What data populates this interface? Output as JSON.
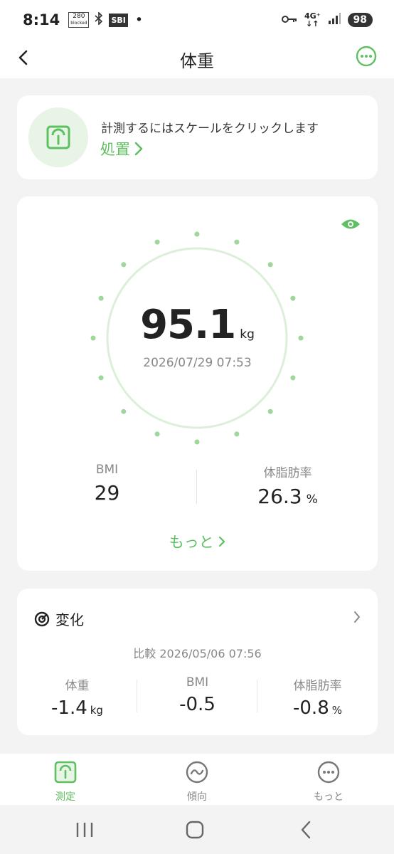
{
  "status_bar": {
    "time": "8:14",
    "notif_top": "280",
    "notif_bottom": "blocked",
    "sbi_label": "SBI",
    "dot": "•",
    "network_top": "4G⁺",
    "network_bottom": "↓↑",
    "battery": "98"
  },
  "header": {
    "title": "体重",
    "back_icon": "chevron-left-icon",
    "more_icon": "more-circle-icon",
    "accent": "#5fbf63"
  },
  "tip": {
    "text": "計測するにはスケールをクリックします",
    "action": "処置",
    "icon": "scale-icon"
  },
  "measurement": {
    "weight": "95.1",
    "unit": "kg",
    "datetime": "2026/07/29 07:53",
    "bmi_label": "BMI",
    "bmi_value": "29",
    "fat_label": "体脂肪率",
    "fat_value": "26.3",
    "fat_unit": "%",
    "more": "もっと"
  },
  "change": {
    "title": "変化",
    "compare": "比較 2026/05/06 07:56",
    "items": [
      {
        "label": "体重",
        "value": "-1.4",
        "unit": "kg"
      },
      {
        "label": "BMI",
        "value": "-0.5",
        "unit": ""
      },
      {
        "label": "体脂肪率",
        "value": "-0.8",
        "unit": "%"
      }
    ]
  },
  "tabs": [
    {
      "label": "測定",
      "icon": "scale-icon",
      "active": true
    },
    {
      "label": "傾向",
      "icon": "trend-icon",
      "active": false
    },
    {
      "label": "もっと",
      "icon": "more-circle-icon",
      "active": false
    }
  ]
}
